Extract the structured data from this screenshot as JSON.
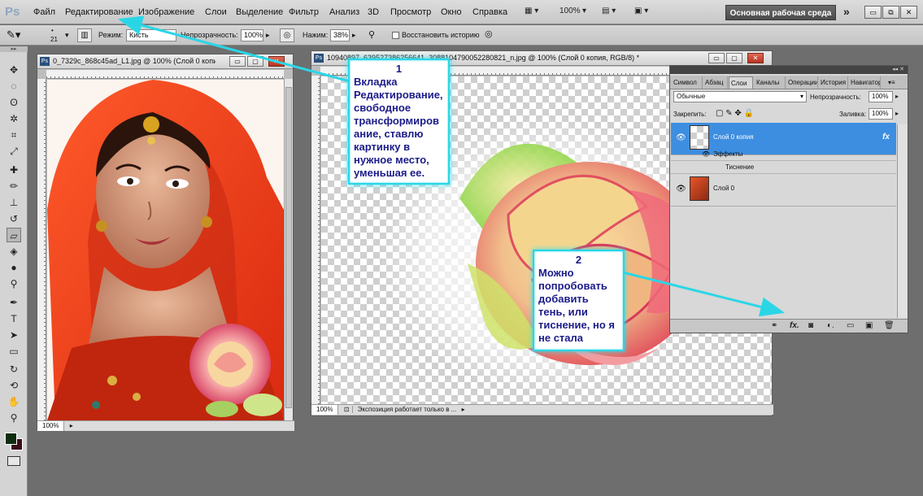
{
  "menu": {
    "logo": "Ps",
    "items": [
      "Файл",
      "Редактирование",
      "Изображение",
      "Слои",
      "Выделение",
      "Фильтр",
      "Анализ",
      "3D",
      "Просмотр",
      "Окно",
      "Справка"
    ],
    "zoom": "100%",
    "workspace": "Основная рабочая среда"
  },
  "options": {
    "brush_size": "21",
    "mode_label": "Режим:",
    "mode_value": "Кисть",
    "opacity_label": "Непрозрачность:",
    "opacity_value": "100%",
    "pressure_label": "Нажим:",
    "pressure_value": "38%",
    "history_label": "Восстановить историю"
  },
  "doc1": {
    "title": "0_7329c_868c45ad_L1.jpg @ 100% (Слой 0 копи...",
    "zoom": "100%"
  },
  "doc2": {
    "title": "10940897_639527386256641_3088104790052280821_n.jpg @ 100% (Слой 0 копия, RGB/8) *",
    "zoom": "100%",
    "status": "Экспозиция работает только в ..."
  },
  "layers_panel": {
    "tabs": [
      "Символ",
      "Абзац",
      "Слои",
      "Каналы",
      "Операции",
      "История",
      "Навигатор"
    ],
    "active_tab": "Слои",
    "blend_mode": "Обычные",
    "opacity_label": "Непрозрачность:",
    "opacity_value": "100%",
    "lock_label": "Закрепить:",
    "fill_label": "Заливка:",
    "fill_value": "100%",
    "layers": [
      {
        "name": "Слой 0 копия",
        "selected": true,
        "fx": "fx"
      },
      {
        "name": "Слой 0",
        "selected": false
      }
    ],
    "effects_label": "Эффекты",
    "effect_name": "Тиснение"
  },
  "callouts": [
    {
      "number": "1",
      "text": "Вкладка\nРедактирование,\nсвободное\nтрансформиров\nание, ставлю\nкартинку в\nнужное место,\nуменьшая ее."
    },
    {
      "number": "2",
      "text": "Можно\nпопробовать\nдобавить\nтень, или\nтиснение, но я\nне стала"
    }
  ],
  "colors": {
    "callout_border": "#2ad6e6",
    "callout_text": "#1b1b8a",
    "selection": "#3d8ee0",
    "workspace_button": "#5a5a5a"
  }
}
